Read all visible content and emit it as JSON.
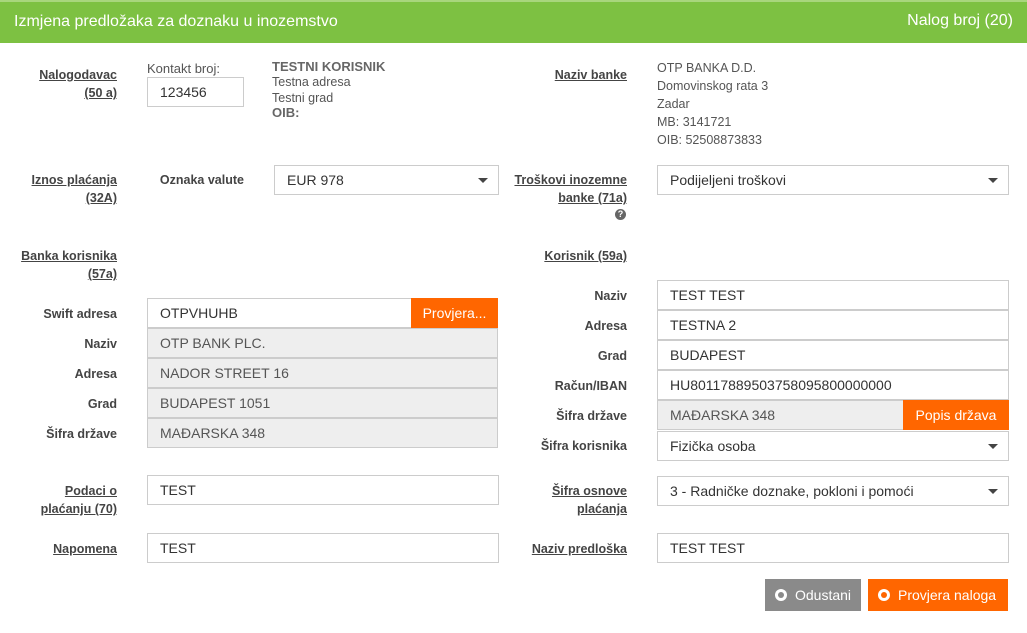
{
  "header": {
    "title": "Izmjena predložaka za doznaku u inozemstvo",
    "order_number": "Nalog broj (20)"
  },
  "payer": {
    "label": "Nalogodavac (50 a)",
    "contact_label": "Kontakt broj:",
    "contact_value": "123456",
    "name": "TESTNI KORISNIK",
    "address": "Testna adresa",
    "city": "Testni grad",
    "oib_label": "OIB:"
  },
  "bank": {
    "label": "Naziv banke",
    "lines": [
      "OTP BANKA D.D.",
      "Domovinskog rata 3",
      "Zadar",
      "MB: 3141721",
      "OIB: 52508873833"
    ]
  },
  "amount": {
    "label": "Iznos plaćanja (32A)",
    "currency_label": "Oznaka valute",
    "currency_value": "EUR 978"
  },
  "fees": {
    "label": "Troškovi inozemne banke (71a)",
    "help_icon": "question-circle-icon",
    "value": "Podijeljeni troškovi"
  },
  "beneficiary_bank": {
    "label": "Banka korisnika (57a)",
    "swift_label": "Swift adresa",
    "swift_value": "OTPVHUHB",
    "check_button": "Provjera...",
    "name_label": "Naziv",
    "name_value": "OTP BANK PLC.",
    "address_label": "Adresa",
    "address_value": "NADOR STREET 16",
    "city_label": "Grad",
    "city_value": "BUDAPEST 1051",
    "country_label": "Šifra države",
    "country_value": "MAĐARSKA 348"
  },
  "beneficiary": {
    "label": "Korisnik (59a)",
    "name_label": "Naziv",
    "name_value": "TEST TEST",
    "address_label": "Adresa",
    "address_value": "TESTNA 2",
    "city_label": "Grad",
    "city_value": "BUDAPEST",
    "iban_label": "Račun/IBAN",
    "iban_value": "HU80117889503758095800000000",
    "country_label": "Šifra države",
    "country_value": "MAĐARSKA 348",
    "country_button": "Popis država",
    "type_label": "Šifra korisnika",
    "type_value": "Fizička osoba"
  },
  "payment_details": {
    "label": "Podaci o plaćanju (70)",
    "value": "TEST"
  },
  "purpose": {
    "label": "Šifra osnove plaćanja",
    "value": "3 - Radničke doznake, pokloni i pomoći"
  },
  "note": {
    "label": "Napomena",
    "value": "TEST"
  },
  "template_name": {
    "label": "Naziv predloška",
    "value": "TEST TEST"
  },
  "actions": {
    "cancel": "Odustani",
    "cancel_icon": "cancel-circle-icon",
    "check": "Provjera naloga",
    "check_icon": "check-circle-icon"
  },
  "colors": {
    "header": "#7dc142",
    "accent": "#ff6600",
    "cancel": "#8a8a8a"
  }
}
